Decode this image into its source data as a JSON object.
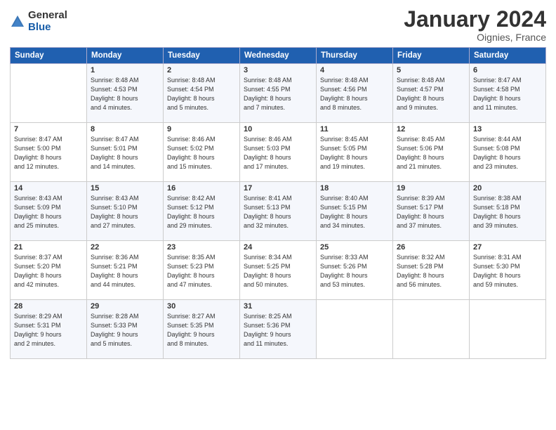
{
  "logo": {
    "general": "General",
    "blue": "Blue"
  },
  "title": "January 2024",
  "location": "Oignies, France",
  "days_header": [
    "Sunday",
    "Monday",
    "Tuesday",
    "Wednesday",
    "Thursday",
    "Friday",
    "Saturday"
  ],
  "weeks": [
    [
      {
        "num": "",
        "info": ""
      },
      {
        "num": "1",
        "info": "Sunrise: 8:48 AM\nSunset: 4:53 PM\nDaylight: 8 hours\nand 4 minutes."
      },
      {
        "num": "2",
        "info": "Sunrise: 8:48 AM\nSunset: 4:54 PM\nDaylight: 8 hours\nand 5 minutes."
      },
      {
        "num": "3",
        "info": "Sunrise: 8:48 AM\nSunset: 4:55 PM\nDaylight: 8 hours\nand 7 minutes."
      },
      {
        "num": "4",
        "info": "Sunrise: 8:48 AM\nSunset: 4:56 PM\nDaylight: 8 hours\nand 8 minutes."
      },
      {
        "num": "5",
        "info": "Sunrise: 8:48 AM\nSunset: 4:57 PM\nDaylight: 8 hours\nand 9 minutes."
      },
      {
        "num": "6",
        "info": "Sunrise: 8:47 AM\nSunset: 4:58 PM\nDaylight: 8 hours\nand 11 minutes."
      }
    ],
    [
      {
        "num": "7",
        "info": "Sunrise: 8:47 AM\nSunset: 5:00 PM\nDaylight: 8 hours\nand 12 minutes."
      },
      {
        "num": "8",
        "info": "Sunrise: 8:47 AM\nSunset: 5:01 PM\nDaylight: 8 hours\nand 14 minutes."
      },
      {
        "num": "9",
        "info": "Sunrise: 8:46 AM\nSunset: 5:02 PM\nDaylight: 8 hours\nand 15 minutes."
      },
      {
        "num": "10",
        "info": "Sunrise: 8:46 AM\nSunset: 5:03 PM\nDaylight: 8 hours\nand 17 minutes."
      },
      {
        "num": "11",
        "info": "Sunrise: 8:45 AM\nSunset: 5:05 PM\nDaylight: 8 hours\nand 19 minutes."
      },
      {
        "num": "12",
        "info": "Sunrise: 8:45 AM\nSunset: 5:06 PM\nDaylight: 8 hours\nand 21 minutes."
      },
      {
        "num": "13",
        "info": "Sunrise: 8:44 AM\nSunset: 5:08 PM\nDaylight: 8 hours\nand 23 minutes."
      }
    ],
    [
      {
        "num": "14",
        "info": "Sunrise: 8:43 AM\nSunset: 5:09 PM\nDaylight: 8 hours\nand 25 minutes."
      },
      {
        "num": "15",
        "info": "Sunrise: 8:43 AM\nSunset: 5:10 PM\nDaylight: 8 hours\nand 27 minutes."
      },
      {
        "num": "16",
        "info": "Sunrise: 8:42 AM\nSunset: 5:12 PM\nDaylight: 8 hours\nand 29 minutes."
      },
      {
        "num": "17",
        "info": "Sunrise: 8:41 AM\nSunset: 5:13 PM\nDaylight: 8 hours\nand 32 minutes."
      },
      {
        "num": "18",
        "info": "Sunrise: 8:40 AM\nSunset: 5:15 PM\nDaylight: 8 hours\nand 34 minutes."
      },
      {
        "num": "19",
        "info": "Sunrise: 8:39 AM\nSunset: 5:17 PM\nDaylight: 8 hours\nand 37 minutes."
      },
      {
        "num": "20",
        "info": "Sunrise: 8:38 AM\nSunset: 5:18 PM\nDaylight: 8 hours\nand 39 minutes."
      }
    ],
    [
      {
        "num": "21",
        "info": "Sunrise: 8:37 AM\nSunset: 5:20 PM\nDaylight: 8 hours\nand 42 minutes."
      },
      {
        "num": "22",
        "info": "Sunrise: 8:36 AM\nSunset: 5:21 PM\nDaylight: 8 hours\nand 44 minutes."
      },
      {
        "num": "23",
        "info": "Sunrise: 8:35 AM\nSunset: 5:23 PM\nDaylight: 8 hours\nand 47 minutes."
      },
      {
        "num": "24",
        "info": "Sunrise: 8:34 AM\nSunset: 5:25 PM\nDaylight: 8 hours\nand 50 minutes."
      },
      {
        "num": "25",
        "info": "Sunrise: 8:33 AM\nSunset: 5:26 PM\nDaylight: 8 hours\nand 53 minutes."
      },
      {
        "num": "26",
        "info": "Sunrise: 8:32 AM\nSunset: 5:28 PM\nDaylight: 8 hours\nand 56 minutes."
      },
      {
        "num": "27",
        "info": "Sunrise: 8:31 AM\nSunset: 5:30 PM\nDaylight: 8 hours\nand 59 minutes."
      }
    ],
    [
      {
        "num": "28",
        "info": "Sunrise: 8:29 AM\nSunset: 5:31 PM\nDaylight: 9 hours\nand 2 minutes."
      },
      {
        "num": "29",
        "info": "Sunrise: 8:28 AM\nSunset: 5:33 PM\nDaylight: 9 hours\nand 5 minutes."
      },
      {
        "num": "30",
        "info": "Sunrise: 8:27 AM\nSunset: 5:35 PM\nDaylight: 9 hours\nand 8 minutes."
      },
      {
        "num": "31",
        "info": "Sunrise: 8:25 AM\nSunset: 5:36 PM\nDaylight: 9 hours\nand 11 minutes."
      },
      {
        "num": "",
        "info": ""
      },
      {
        "num": "",
        "info": ""
      },
      {
        "num": "",
        "info": ""
      }
    ]
  ]
}
